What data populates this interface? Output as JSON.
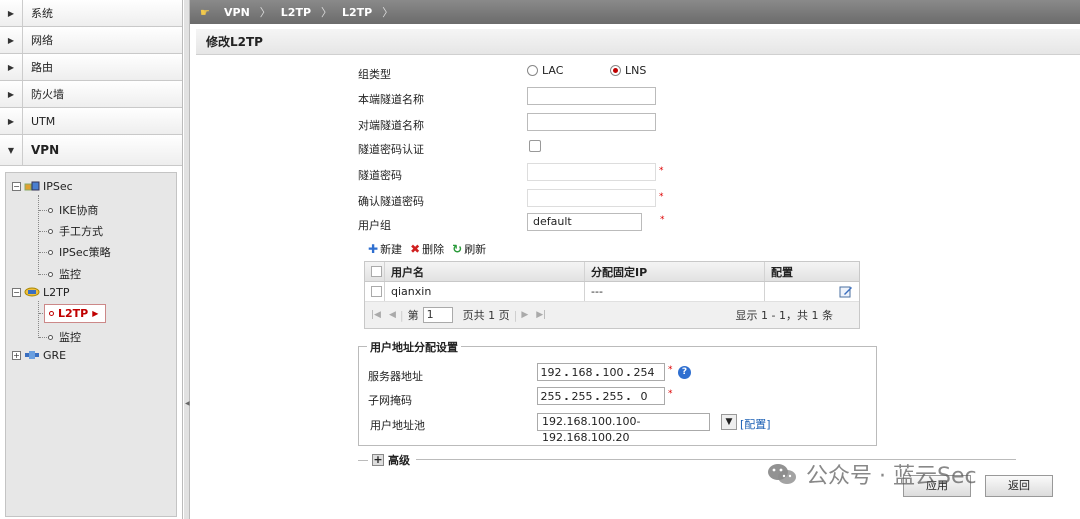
{
  "sidebar": {
    "menu": [
      {
        "label": "系统"
      },
      {
        "label": "网络"
      },
      {
        "label": "路由"
      },
      {
        "label": "防火墙"
      },
      {
        "label": "UTM"
      },
      {
        "label": "VPN"
      }
    ],
    "tree": {
      "ipsec": "IPSec",
      "ipsec_children": [
        "IKE协商",
        "手工方式",
        "IPSec策略",
        "监控"
      ],
      "l2tp": "L2TP",
      "l2tp_children": [
        "L2TP",
        "监控"
      ],
      "gre": "GRE"
    }
  },
  "breadcrumb": [
    "VPN",
    "L2TP",
    "L2TP"
  ],
  "page_title": "修改L2TP",
  "form": {
    "group_type_label": "组类型",
    "option_lac": "LAC",
    "option_lns": "LNS",
    "selected": "LNS",
    "local_tunnel_label": "本端隧道名称",
    "local_tunnel_value": "",
    "peer_tunnel_label": "对端隧道名称",
    "peer_tunnel_value": "",
    "tunnel_auth_label": "隧道密码认证",
    "tunnel_pwd_label": "隧道密码",
    "confirm_pwd_label": "确认隧道密码",
    "user_group_label": "用户组",
    "user_group_value": "default",
    "required": "*"
  },
  "grid": {
    "toolbar": {
      "add": "新建",
      "delete": "删除",
      "refresh": "刷新"
    },
    "columns": [
      "用户名",
      "分配固定IP",
      "配置"
    ],
    "rows": [
      {
        "username": "qianxin",
        "ip": "---"
      }
    ],
    "pager": {
      "page_label": "第",
      "page": "1",
      "total": "页共 1 页",
      "summary": "显示 1 - 1，共 1 条"
    }
  },
  "alloc": {
    "legend": "用户地址分配设置",
    "server_label": "服务器地址",
    "server_ip": [
      "192",
      "168",
      "100",
      "254"
    ],
    "mask_label": "子网掩码",
    "mask": [
      "255",
      "255",
      "255",
      "0"
    ],
    "pool_label": "用户地址池",
    "pool_value": "192.168.100.100-192.168.100.20",
    "pool_link": "[配置]"
  },
  "advanced": "高级",
  "buttons": {
    "apply": "应用",
    "back": "返回"
  },
  "watermark": "公众号 · 蓝云Sec"
}
